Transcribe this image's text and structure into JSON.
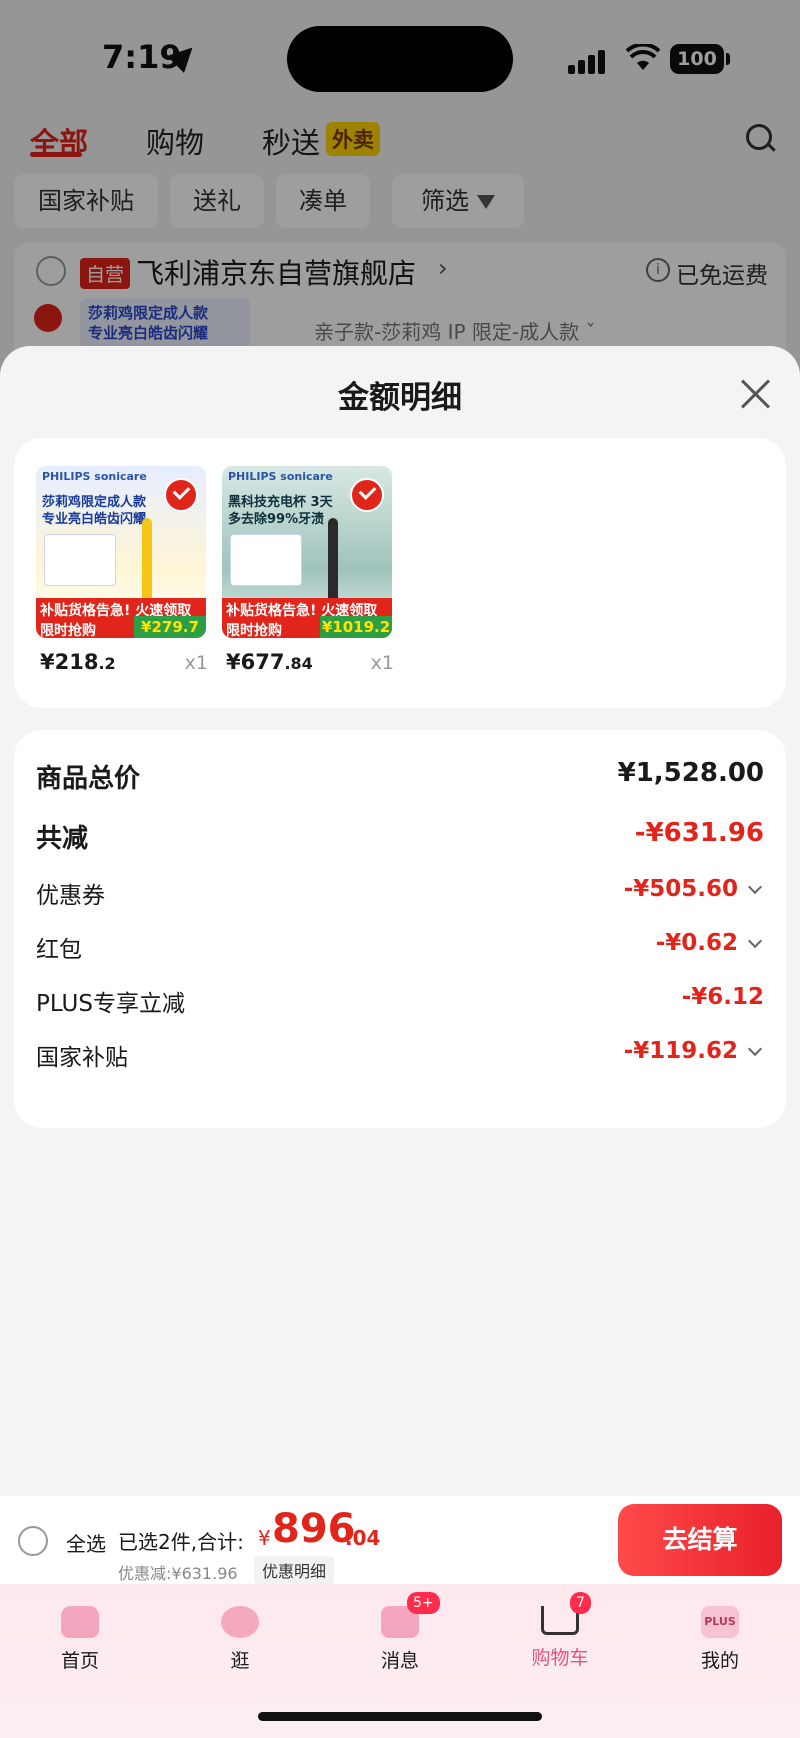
{
  "status_bar": {
    "time": "7:19",
    "battery": "100"
  },
  "top_tabs": [
    {
      "label": "全部",
      "active": true
    },
    {
      "label": "购物",
      "active": false
    },
    {
      "label": "秒送",
      "active": false
    }
  ],
  "waimai_badge": "外卖",
  "chips": [
    "国家补贴",
    "送礼",
    "凑单",
    "筛选"
  ],
  "store": {
    "self_badge": "自营",
    "name": "飞利浦京东自营旗舰店",
    "arrow": "›",
    "free_shipping": "已免运费",
    "variant": "亲子款-莎莉鸡 IP 限定-成人款 ˇ",
    "thumb_line1": "莎莉鸡限定成人款",
    "thumb_line2": "专业亮白皓齿闪耀"
  },
  "modal": {
    "title": "金额明细",
    "products": [
      {
        "brand": "PHILIPS sonicare",
        "headline": "莎莉鸡限定成人款 专业亮白皓齿闪耀",
        "banner": "补贴货格告急! 火速领取 限时抢购",
        "tag_price": "¥279.7",
        "price_int": "¥218",
        "price_dec": ".2",
        "qty": "x1"
      },
      {
        "brand": "PHILIPS sonicare",
        "headline": "黑科技充电杯 3天多去除99%牙渍",
        "banner": "补贴货格告急! 火速领取 限时抢购",
        "tag_price": "¥1019.2",
        "price_int": "¥677",
        "price_dec": ".84",
        "qty": "x1"
      }
    ],
    "details": [
      {
        "label": "商品总价",
        "value": "¥1,528.00",
        "big": true,
        "color": "#1a1a1a",
        "chevron": false
      },
      {
        "label": "共减",
        "value": "-¥631.96",
        "big": true,
        "color": "#e1251b",
        "chevron": false
      },
      {
        "label": "优惠券",
        "value": "-¥505.60",
        "big": false,
        "color": "#e1251b",
        "chevron": true
      },
      {
        "label": "红包",
        "value": "-¥0.62",
        "big": false,
        "color": "#e1251b",
        "chevron": true
      },
      {
        "label": "PLUS专享立减",
        "value": "-¥6.12",
        "big": false,
        "color": "#e1251b",
        "chevron": false
      },
      {
        "label": "国家补贴",
        "value": "-¥119.62",
        "big": false,
        "color": "#e1251b",
        "chevron": true
      }
    ]
  },
  "checkout": {
    "select_all": "全选",
    "selected_summary": "已选2件,合计:",
    "currency": "¥",
    "total_int": "896",
    "total_dec": ".04",
    "discount_line": "优惠减:¥631.96",
    "detail_link": "优惠明细",
    "pay_button": "去结算"
  },
  "tab_bar": [
    {
      "label": "首页",
      "icon": "home-icon",
      "badge": ""
    },
    {
      "label": "逛",
      "icon": "mascot-icon",
      "badge": ""
    },
    {
      "label": "消息",
      "icon": "message-icon",
      "badge": "5+"
    },
    {
      "label": "购物车",
      "icon": "cart-icon",
      "badge": "7",
      "active": true
    },
    {
      "label": "我的",
      "icon": "plus-icon",
      "badge": "",
      "icon_text": "PLUS"
    }
  ],
  "colors": {
    "accent": "#e1251b",
    "pay_button": "#e8202a",
    "tab_active": "#e3577a"
  }
}
